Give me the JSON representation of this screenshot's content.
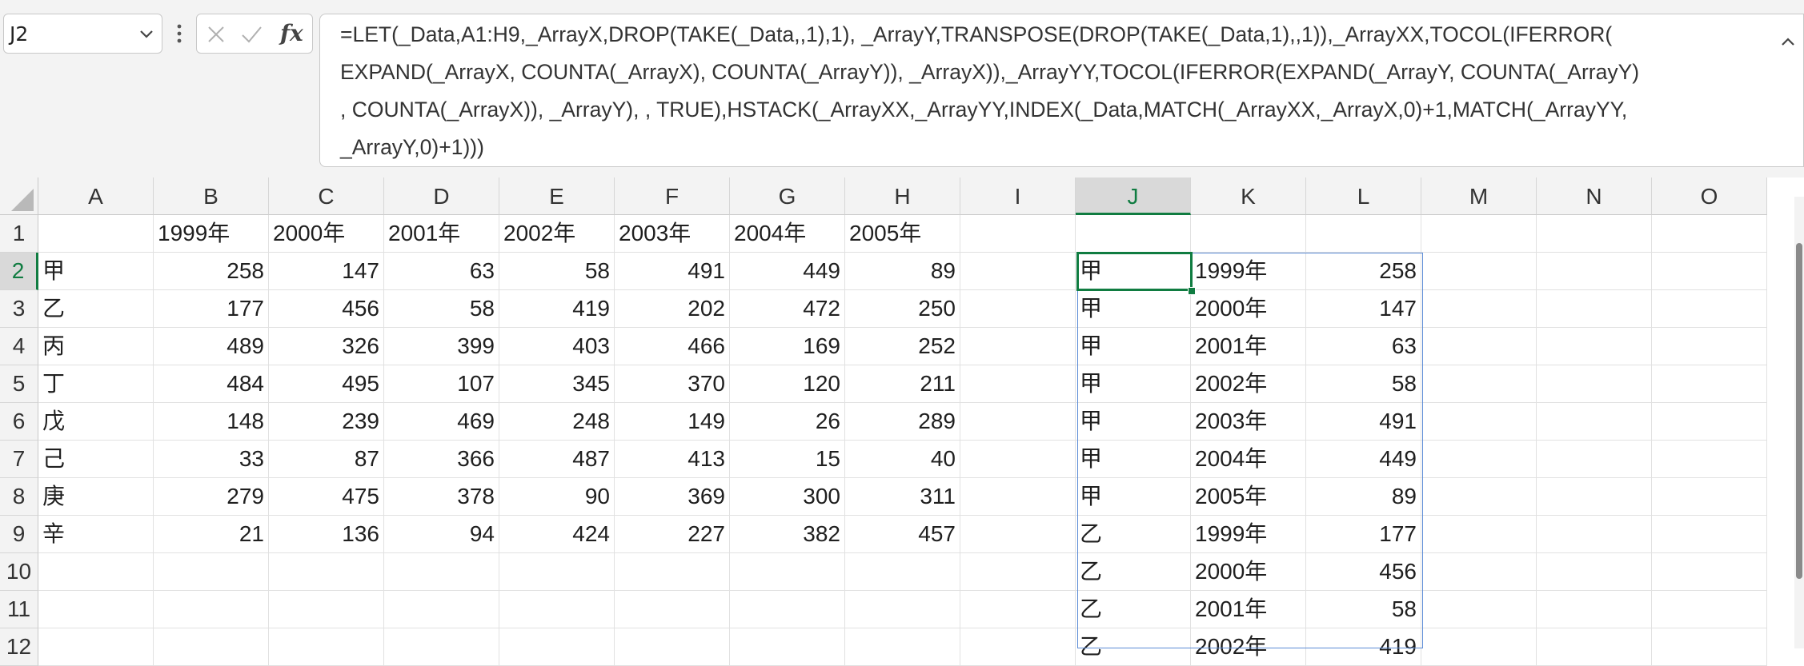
{
  "name_box": {
    "value": "J2"
  },
  "formula_bar": {
    "fx_label": "fx",
    "lines": [
      "=LET(_Data,A1:H9,_ArrayX,DROP(TAKE(_Data,,1),1), _ArrayY,TRANSPOSE(DROP(TAKE(_Data,1),,1)),_ArrayXX,TOCOL(IFERROR(",
      "EXPAND(_ArrayX, COUNTA(_ArrayX), COUNTA(_ArrayY)), _ArrayX)),_ArrayYY,TOCOL(IFERROR(EXPAND(_ArrayY, COUNTA(_ArrayY)",
      ", COUNTA(_ArrayX)), _ArrayY), , TRUE),HSTACK(_ArrayXX,_ArrayYY,INDEX(_Data,MATCH(_ArrayXX,_ArrayX,0)+1,MATCH(_ArrayYY,",
      "_ArrayY,0)+1)))"
    ]
  },
  "columns": [
    "A",
    "B",
    "C",
    "D",
    "E",
    "F",
    "G",
    "H",
    "I",
    "J",
    "K",
    "L",
    "M",
    "N",
    "O"
  ],
  "selected_column": "J",
  "rows": [
    "1",
    "2",
    "3",
    "4",
    "5",
    "6",
    "7",
    "8",
    "9",
    "10",
    "11",
    "12"
  ],
  "selected_row": "2",
  "source_table": {
    "years": [
      "1999年",
      "2000年",
      "2001年",
      "2002年",
      "2003年",
      "2004年",
      "2005年"
    ],
    "records": [
      {
        "label": "甲",
        "values": [
          "258",
          "147",
          "63",
          "58",
          "491",
          "449",
          "89"
        ]
      },
      {
        "label": "乙",
        "values": [
          "177",
          "456",
          "58",
          "419",
          "202",
          "472",
          "250"
        ]
      },
      {
        "label": "丙",
        "values": [
          "489",
          "326",
          "399",
          "403",
          "466",
          "169",
          "252"
        ]
      },
      {
        "label": "丁",
        "values": [
          "484",
          "495",
          "107",
          "345",
          "370",
          "120",
          "211"
        ]
      },
      {
        "label": "戊",
        "values": [
          "148",
          "239",
          "469",
          "248",
          "149",
          "26",
          "289"
        ]
      },
      {
        "label": "己",
        "values": [
          "33",
          "87",
          "366",
          "487",
          "413",
          "15",
          "40"
        ]
      },
      {
        "label": "庚",
        "values": [
          "279",
          "475",
          "378",
          "90",
          "369",
          "300",
          "311"
        ]
      },
      {
        "label": "辛",
        "values": [
          "21",
          "136",
          "94",
          "424",
          "227",
          "382",
          "457"
        ]
      }
    ]
  },
  "spill_result": [
    {
      "name": "甲",
      "year": "1999年",
      "value": "258"
    },
    {
      "name": "甲",
      "year": "2000年",
      "value": "147"
    },
    {
      "name": "甲",
      "year": "2001年",
      "value": "63"
    },
    {
      "name": "甲",
      "year": "2002年",
      "value": "58"
    },
    {
      "name": "甲",
      "year": "2003年",
      "value": "491"
    },
    {
      "name": "甲",
      "year": "2004年",
      "value": "449"
    },
    {
      "name": "甲",
      "year": "2005年",
      "value": "89"
    },
    {
      "name": "乙",
      "year": "1999年",
      "value": "177"
    },
    {
      "name": "乙",
      "year": "2000年",
      "value": "456"
    },
    {
      "name": "乙",
      "year": "2001年",
      "value": "58"
    },
    {
      "name": "乙",
      "year": "2002年",
      "value": "419"
    }
  ]
}
